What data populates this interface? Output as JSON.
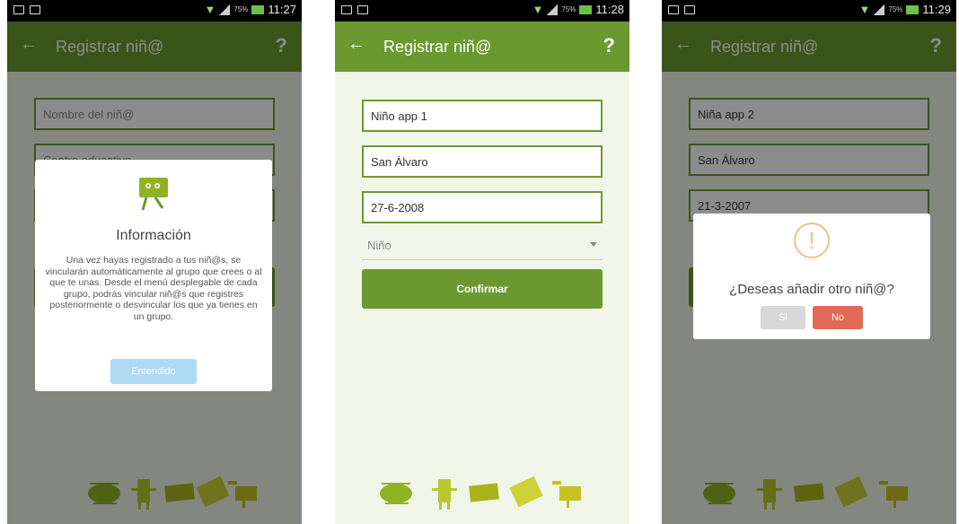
{
  "screens": [
    {
      "status_time": "11:27",
      "battery": "75%",
      "title": "Registrar niñ@",
      "help": "?",
      "fields": [
        "Nombre del niñ@",
        "Centro educativo"
      ],
      "dialog": {
        "title": "Información",
        "body": "Una vez hayas registrado a tus niñ@s, se vincularán automáticamente al grupo que crees o al que te unas. Desde el menú desplegable de cada grupo, podrás vincular niñ@s que registres posteriormente o desvincular los que ya tienes en un grupo.",
        "button": "Entendido"
      }
    },
    {
      "status_time": "11:28",
      "battery": "75%",
      "title": "Registrar niñ@",
      "help": "?",
      "fields": [
        "Niño app 1",
        "San Álvaro",
        "27-6-2008"
      ],
      "dropdown": "Niño",
      "confirm": "Confirmar"
    },
    {
      "status_time": "11:29",
      "battery": "75%",
      "title": "Registrar niñ@",
      "help": "?",
      "fields": [
        "Niña app 2",
        "San Álvaro",
        "21-3-2007"
      ],
      "dialog": {
        "question": "¿Deseas añadir otro niñ@?",
        "yes": "Si",
        "no": "No"
      }
    }
  ],
  "colors": {
    "appbar": "#6a9a2f",
    "background": "#f1f6e9",
    "info_button": "#aedaf4",
    "no_button": "#e06a55",
    "warning": "#f5be8a"
  },
  "icons": [
    "back-arrow-icon",
    "help-icon",
    "warning-icon",
    "mascot-logo-icon"
  ]
}
